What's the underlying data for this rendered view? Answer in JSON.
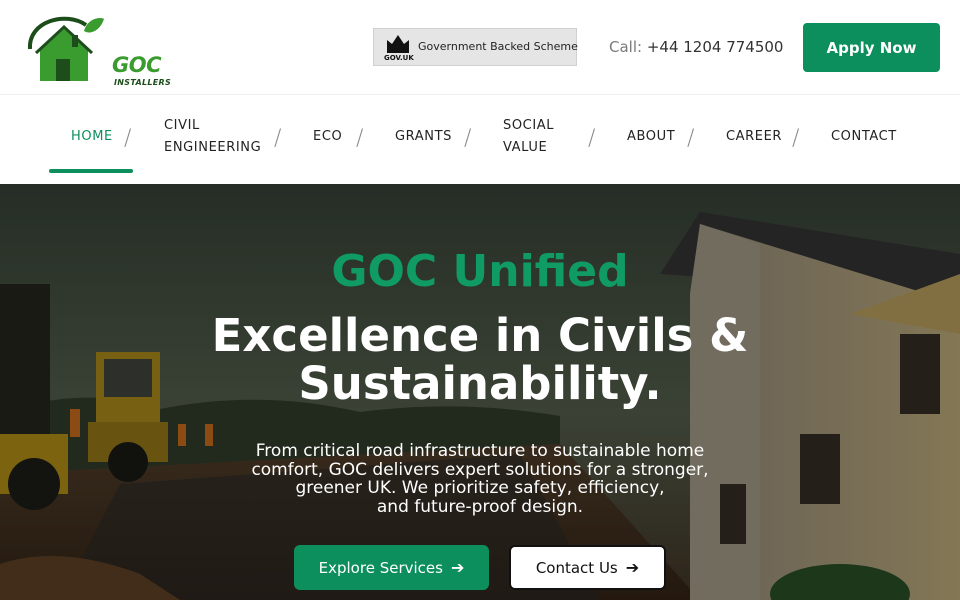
{
  "brand": {
    "logo_text": "GOC",
    "logo_sub": "INSTALLERS",
    "colors": {
      "primary": "#0d8f5d",
      "logo_green": "#3a9b2f",
      "logo_dark": "#1c4d1a"
    }
  },
  "header": {
    "gov_badge": {
      "label": "Government Backed Scheme",
      "sub": "GOV.UK",
      "icon": "crown-icon"
    },
    "phone": {
      "label": "Call:",
      "number": "+44 1204 774500"
    },
    "apply_label": "Apply Now"
  },
  "nav": {
    "items": [
      {
        "label": "HOME",
        "active": true
      },
      {
        "label": "CIVIL",
        "label2": "ENGINEERING"
      },
      {
        "label": "ECO"
      },
      {
        "label": "GRANTS"
      },
      {
        "label": "SOCIAL",
        "label2": "VALUE"
      },
      {
        "label": "ABOUT"
      },
      {
        "label": "CAREER"
      },
      {
        "label": "CONTACT"
      }
    ],
    "separator": "/"
  },
  "hero": {
    "eyebrow": "GOC Unified",
    "title_line1": "Excellence in Civils &",
    "title_line2": "Sustainability.",
    "desc_line1": "From critical road infrastructure to sustainable home",
    "desc_line2": "comfort, GOC delivers expert solutions for a stronger,",
    "desc_line3": "greener UK. We prioritize safety, efficiency,",
    "desc_line4": "and future-proof design.",
    "explore_label": "Explore Services",
    "contact_label": "Contact Us",
    "arrow_icon": "arrow-right-icon"
  }
}
